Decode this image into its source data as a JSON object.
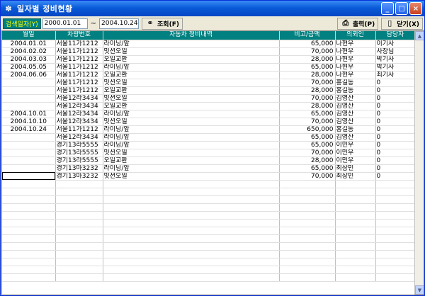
{
  "window": {
    "title": "일자별 정비현황",
    "controls": [
      "_",
      "□",
      "×"
    ]
  },
  "toolbar": {
    "search_label": "검색일자(Y)",
    "date_from": "2000.01.01",
    "tilde": "~",
    "date_to": "2004.10.24",
    "query_label": "조회(F)",
    "print_label": "출력(P)",
    "close_label": "닫기(X)"
  },
  "table": {
    "columns": [
      "월일",
      "차량번호",
      "자동차 정비내역",
      "비고/금액",
      "의뢰인",
      "담당자"
    ],
    "rows": [
      [
        "2004.01.01",
        "서울11가1212",
        "라이닝/앞",
        "65,000",
        "나현우",
        "이기사"
      ],
      [
        "2004.02.02",
        "서울11가1212",
        "밋션오일",
        "70,000",
        "나현우",
        "사장님"
      ],
      [
        "2004.03.03",
        "서울11가1212",
        "오일교환",
        "28,000",
        "나현우",
        "박기사"
      ],
      [
        "2004.05.05",
        "서울11가1212",
        "라이닝/앞",
        "65,000",
        "나현우",
        "박기사"
      ],
      [
        "2004.06.06",
        "서울11가1212",
        "오일교환",
        "28,000",
        "나현우",
        "최기사"
      ],
      [
        "",
        "서울11가1212",
        "밋션오일",
        "70,000",
        "홍길동",
        "0"
      ],
      [
        "",
        "서울11가1212",
        "오일교환",
        "28,000",
        "홍길동",
        "0"
      ],
      [
        "",
        "서울12라3434",
        "밋션오일",
        "70,000",
        "김영산",
        "0"
      ],
      [
        "",
        "서울12라3434",
        "오일교환",
        "28,000",
        "김영산",
        "0"
      ],
      [
        "2004.10.01",
        "서울12라3434",
        "라이닝/앞",
        "65,000",
        "김영산",
        "0"
      ],
      [
        "2004.10.10",
        "서울12라3434",
        "밋션오일",
        "70,000",
        "김영산",
        "0"
      ],
      [
        "2004.10.24",
        "서울11가1212",
        "라이닝/앞",
        "650,000",
        "홍길동",
        "0"
      ],
      [
        "",
        "서울12라3434",
        "라이닝/앞",
        "65,000",
        "김영산",
        "0"
      ],
      [
        "",
        "경기13라5555",
        "라이닝/앞",
        "65,000",
        "이민우",
        "0"
      ],
      [
        "",
        "경기13라5555",
        "밋션오일",
        "70,000",
        "이민우",
        "0"
      ],
      [
        "",
        "경기13라5555",
        "오일교환",
        "28,000",
        "이민우",
        "0"
      ],
      [
        "",
        "경기13마3232",
        "라이닝/앞",
        "65,000",
        "최상민",
        "0"
      ],
      [
        "",
        "경기13마3232",
        "밋션오일",
        "70,000",
        "최상민",
        "0"
      ]
    ],
    "empty_rows": 13
  }
}
